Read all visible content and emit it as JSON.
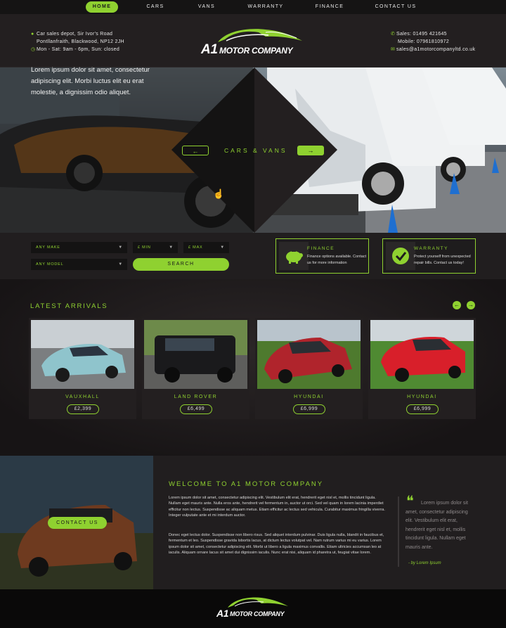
{
  "nav": {
    "items": [
      {
        "label": "HOME",
        "active": true
      },
      {
        "label": "CARS"
      },
      {
        "label": "VANS"
      },
      {
        "label": "WARRANTY"
      },
      {
        "label": "FINANCE"
      },
      {
        "label": "CONTACT US"
      }
    ]
  },
  "header": {
    "address_line1": "Car sales depot, Sir Ivor's Road",
    "address_line2": "Pontllanfraith, Blackwood, NP12 2JH",
    "hours": "Mon - Sat: 9am - 6pm, Sun: closed",
    "logo_a1": "A1",
    "logo_rest": "MOTOR COMPANY",
    "sales": "Sales: 01495 421645",
    "mobile": "Mobile: 07961810972",
    "email": "sales@a1motorcompanyltd.co.uk"
  },
  "hero": {
    "text": "Lorem ipsum dolor sit amet, consectetur adipiscing elit. Morbi luctus elit eu erat molestie, a dignissim odio aliquet.",
    "switcher_label": "CARS  &  VANS"
  },
  "search": {
    "make": "ANY MAKE",
    "min": "£ MIN",
    "max": "£ MAX",
    "model": "ANY MODEL",
    "button": "SEARCH"
  },
  "finance": {
    "title": "FINANCE",
    "text": "Finance options available. Contact us for more information"
  },
  "warranty": {
    "title": "WARRANTY",
    "text": "Protect yourself from unexpected repair bills. Contact us today!"
  },
  "arrivals": {
    "title": "LATEST ARRIVALS",
    "cars": [
      {
        "name": "VAUXHALL",
        "price": "£2,399",
        "color": "#8fc4cc"
      },
      {
        "name": "LAND ROVER",
        "price": "£6,499",
        "color": "#1a1a1c"
      },
      {
        "name": "HYUNDAI",
        "price": "£6,999",
        "color": "#b0242c"
      },
      {
        "name": "HYUNDAI",
        "price": "£6,999",
        "color": "#d81f2a"
      }
    ]
  },
  "welcome": {
    "title": "WELCOME TO A1 MOTOR COMPANY",
    "contact_button": "CONTACT US",
    "para1": "Lorem ipsum dolor sit amet, consectetur adipiscing elit. Vestibulum elit erat, hendrerit eget nisl et, mollis tincidunt ligula. Nullam eget mauris ante. Nulla eros ante, hendrerit vel fermentum in, auctor ut orci. Sed vel quam in lorem lacinia imperdiet efficitur non lectus. Suspendisse ac aliquam metus. Etiam efficitur ac lectus sed vehicula. Curabitur maximus fringilla viverra. Integer vulputate ante et mi interdum auctor.",
    "para2": "Donec eget lectus dolor. Suspendisse non libero risus. Sed aliquet interdum pulvinar. Duis ligula nulla, blandit in faucibus et, fermentum et leo. Suspendisse gravida lobortis lacus, at dictum lectus volutpat vel. Nam rutrum varius mi eu varius. Lorem ipsum dolor sit amet, consectetur adipiscing elit. Morbi ut libero a ligula maximus convallis. Etiam ultricies accumsan leo at iaculis. Aliquam ornare lacus sit amet dui dignissim iaculis. Nunc erat nisi, aliquam id pharetra ut, feugiat vitae lorem.",
    "quote": "Lorem ipsum dolor sit amet, consectetur adipiscing elit. Vestibulum elit erat, hendrerit eget nisl et, mollis tincidunt ligula. Nullam eget mauris ante.",
    "quote_by": "- by Lorem Ipsum"
  },
  "colors": {
    "accent": "#8fd130",
    "background": "#1e1c1d"
  }
}
